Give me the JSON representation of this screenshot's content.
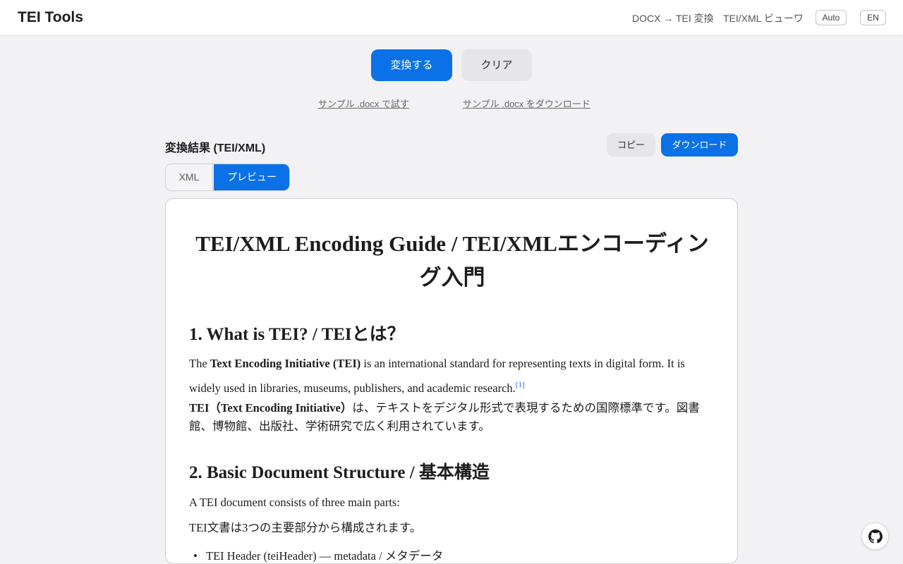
{
  "header": {
    "brand": "TEI Tools",
    "nav": [
      "DOCX → TEI 変換",
      "TEI/XML ビューワ"
    ],
    "theme_label": "Auto",
    "lang_label": "EN"
  },
  "actions": {
    "convert_label": "変換する",
    "clear_label": "クリア",
    "sample_try": "サンプル .docx で試す",
    "sample_download": "サンプル .docx をダウンロード"
  },
  "result": {
    "title": "変換結果 (TEI/XML)",
    "copy_label": "コピー",
    "download_label": "ダウンロード",
    "tabs": [
      "XML",
      "プレビュー"
    ],
    "active_tab": "プレビュー"
  },
  "preview": {
    "title": "TEI/XML Encoding Guide / TEI/XMLエンコーディング入門",
    "section1_heading": "1. What is TEI? / TEIとは？",
    "p1_before": "The ",
    "p1_bold": "Text Encoding Initiative (TEI)",
    "p1_after": " is an international standard for representing texts in digital form. It is widely used in libraries, museums, publishers, and academic research.",
    "p1_footnote": "[1]",
    "p2_bold": "TEI（Text Encoding Initiative）",
    "p2_rest": "は、テキストをデジタル形式で表現するための国際標準です。図書館、博物館、出版社、学術研究で広く利用されています。",
    "section2_heading": "2. Basic Document Structure / 基本構造",
    "p3": "A TEI document consists of three main parts:",
    "p4": "TEI文書は3つの主要部分から構成されます。",
    "list": [
      "TEI Header (teiHeader) — metadata / メタデータ"
    ]
  },
  "icons": {
    "github": "github-icon"
  }
}
